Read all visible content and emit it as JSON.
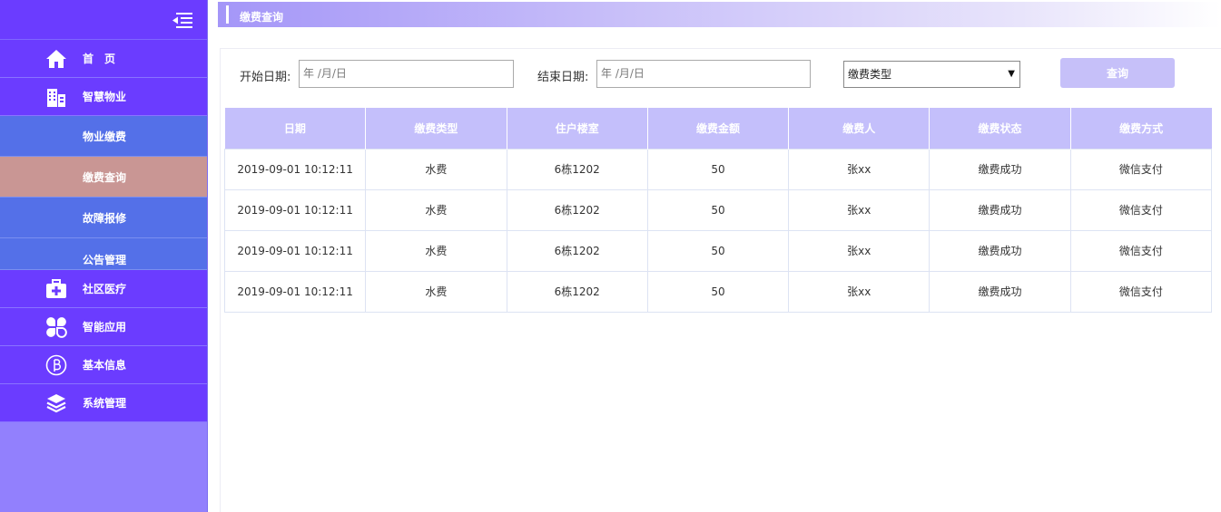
{
  "sidebar": {
    "menu": [
      {
        "label": "首　页",
        "icon": "home-icon"
      },
      {
        "label": "智慧物业",
        "icon": "building-icon"
      }
    ],
    "submenu": [
      {
        "label": "物业缴费"
      },
      {
        "label": "缴费查询",
        "active": true
      },
      {
        "label": "故障报修"
      },
      {
        "label": "公告管理"
      }
    ],
    "menu2": [
      {
        "label": "社区医疗",
        "icon": "medical-kit-icon"
      },
      {
        "label": "智能应用",
        "icon": "apps-icon"
      },
      {
        "label": "基本信息",
        "icon": "info-b-icon"
      },
      {
        "label": "系统管理",
        "icon": "layers-icon"
      }
    ]
  },
  "header": {
    "title": "缴费查询"
  },
  "filters": {
    "start_label": "开始日期:",
    "start_placeholder": "年 /月/日",
    "end_label": "结束日期:",
    "end_placeholder": "年 /月/日",
    "type_select": "缴费类型",
    "query_button": "查询"
  },
  "table": {
    "columns": [
      "日期",
      "缴费类型",
      "住户楼室",
      "缴费金额",
      "缴费人",
      "缴费状态",
      "缴费方式"
    ],
    "rows": [
      [
        "2019-09-01 10:12:11",
        "水费",
        "6栋1202",
        "50",
        "张xx",
        "缴费成功",
        "微信支付"
      ],
      [
        "2019-09-01 10:12:11",
        "水费",
        "6栋1202",
        "50",
        "张xx",
        "缴费成功",
        "微信支付"
      ],
      [
        "2019-09-01 10:12:11",
        "水费",
        "6栋1202",
        "50",
        "张xx",
        "缴费成功",
        "微信支付"
      ],
      [
        "2019-09-01 10:12:11",
        "水费",
        "6栋1202",
        "50",
        "张xx",
        "缴费成功",
        "微信支付"
      ]
    ]
  },
  "colors": {
    "sidebar_primary": "#6b3cff",
    "sidebar_sub": "#5470e8",
    "sidebar_active": "#c99694",
    "table_header": "#c4bffb"
  }
}
